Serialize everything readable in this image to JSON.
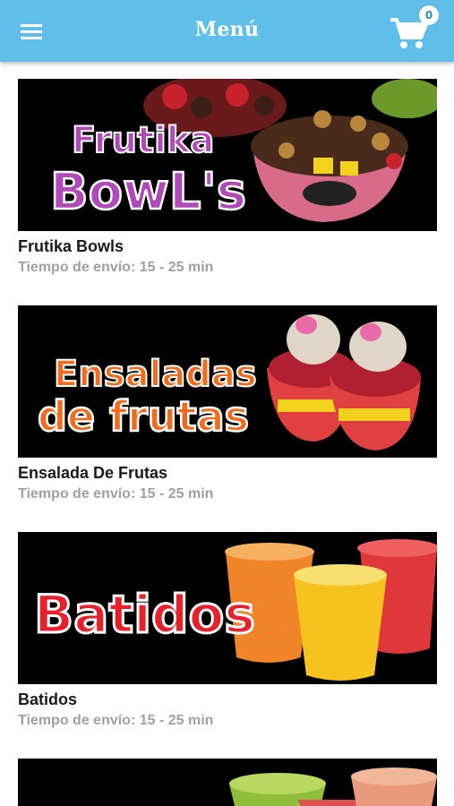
{
  "header": {
    "title": "Menú",
    "cart_count": "0",
    "menu_icon": "hamburger-menu-icon",
    "cart_icon": "shopping-cart-icon",
    "bar_color": "#5fbfe8"
  },
  "categories": [
    {
      "banner_line1": "Frutika",
      "banner_line2": "BowL's",
      "banner_color": "#b04ab8",
      "title": "Frutika Bowls",
      "subtitle": "Tiempo de envío: 15 - 25 min"
    },
    {
      "banner_line1": "Ensaladas",
      "banner_line2": "de frutas",
      "banner_color": "#f26b1d",
      "title": "Ensalada De Frutas",
      "subtitle": "Tiempo de envío: 15 - 25 min"
    },
    {
      "banner_line1": "Batidos",
      "banner_color": "#e8202a",
      "title": "Batidos",
      "subtitle": "Tiempo de envío: 15 - 25 min"
    },
    {
      "banner_color": "#8fbf3a"
    }
  ]
}
